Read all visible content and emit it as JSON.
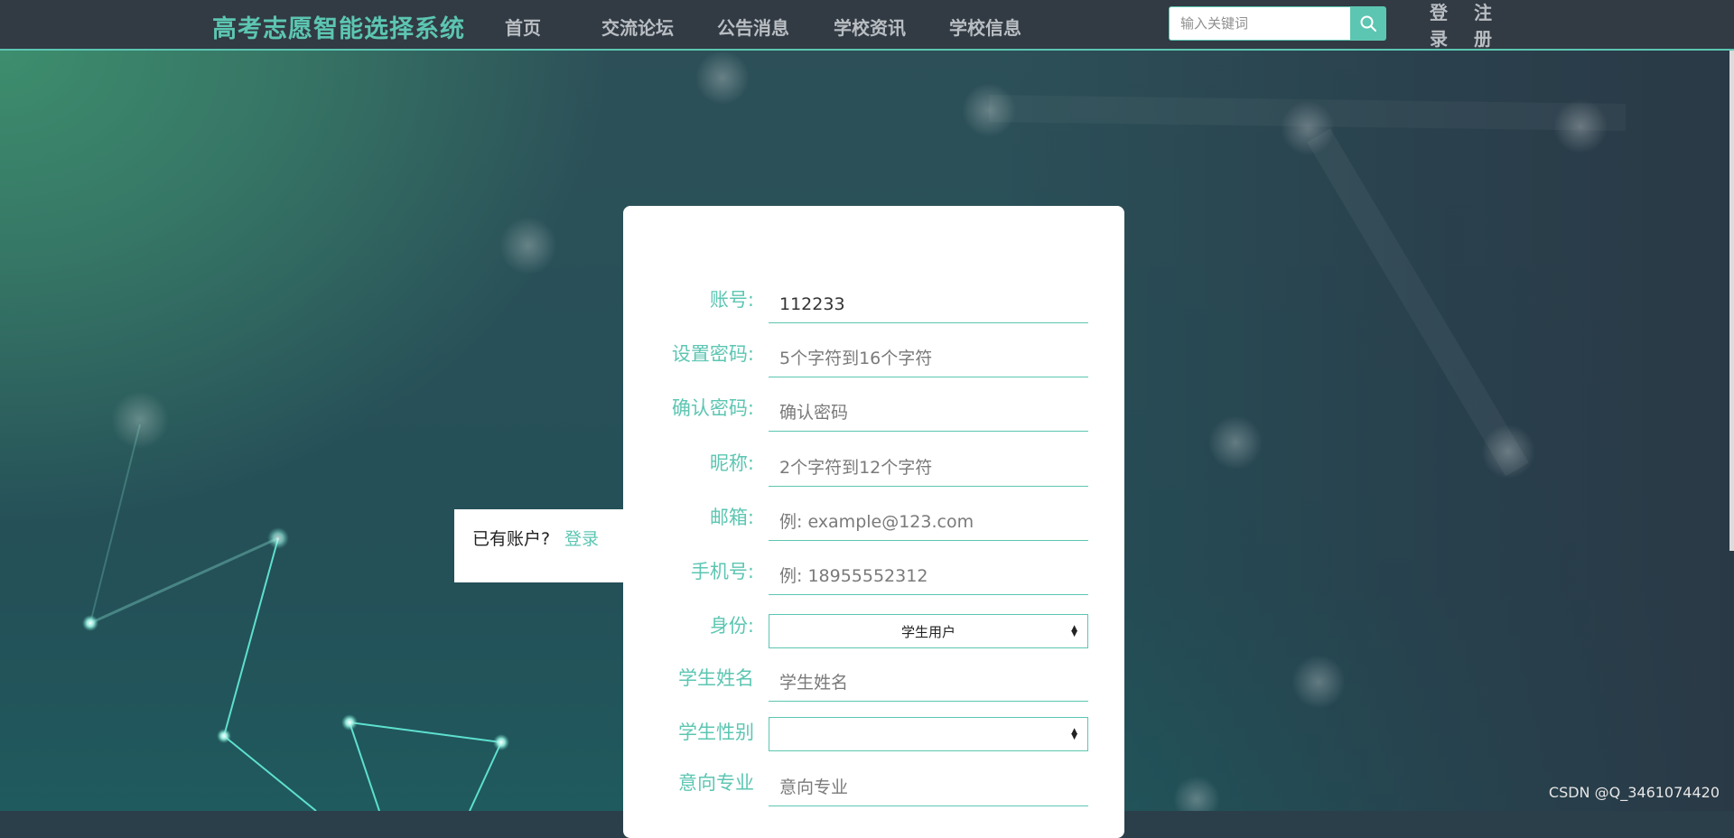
{
  "brand": "高考志愿智能选择系统",
  "nav": {
    "items": [
      "首页",
      "交流论坛",
      "公告消息",
      "学校资讯",
      "学校信息"
    ]
  },
  "search": {
    "placeholder": "输入关键词",
    "icon": "search-icon"
  },
  "auth": {
    "login": "登录",
    "register": "注册"
  },
  "side_box": {
    "text": "已有账户?",
    "link": "登录"
  },
  "form": {
    "account": {
      "label": "账号:",
      "value": "112233"
    },
    "password": {
      "label": "设置密码:",
      "placeholder": "5个字符到16个字符"
    },
    "confirm": {
      "label": "确认密码:",
      "placeholder": "确认密码"
    },
    "nickname": {
      "label": "昵称:",
      "placeholder": "2个字符到12个字符"
    },
    "email": {
      "label": "邮箱:",
      "placeholder": "例: example@123.com"
    },
    "phone": {
      "label": "手机号:",
      "placeholder": "例: 18955552312"
    },
    "identity": {
      "label": "身份:",
      "selected": "学生用户"
    },
    "student_name": {
      "label": "学生姓名",
      "placeholder": "学生姓名"
    },
    "student_gender": {
      "label": "学生性别",
      "selected": ""
    },
    "major": {
      "label": "意向专业",
      "placeholder": "意向专业"
    }
  },
  "watermark": "CSDN @Q_3461074420",
  "colors": {
    "accent": "#5cc6b2",
    "nav_bg": "#323a43"
  }
}
